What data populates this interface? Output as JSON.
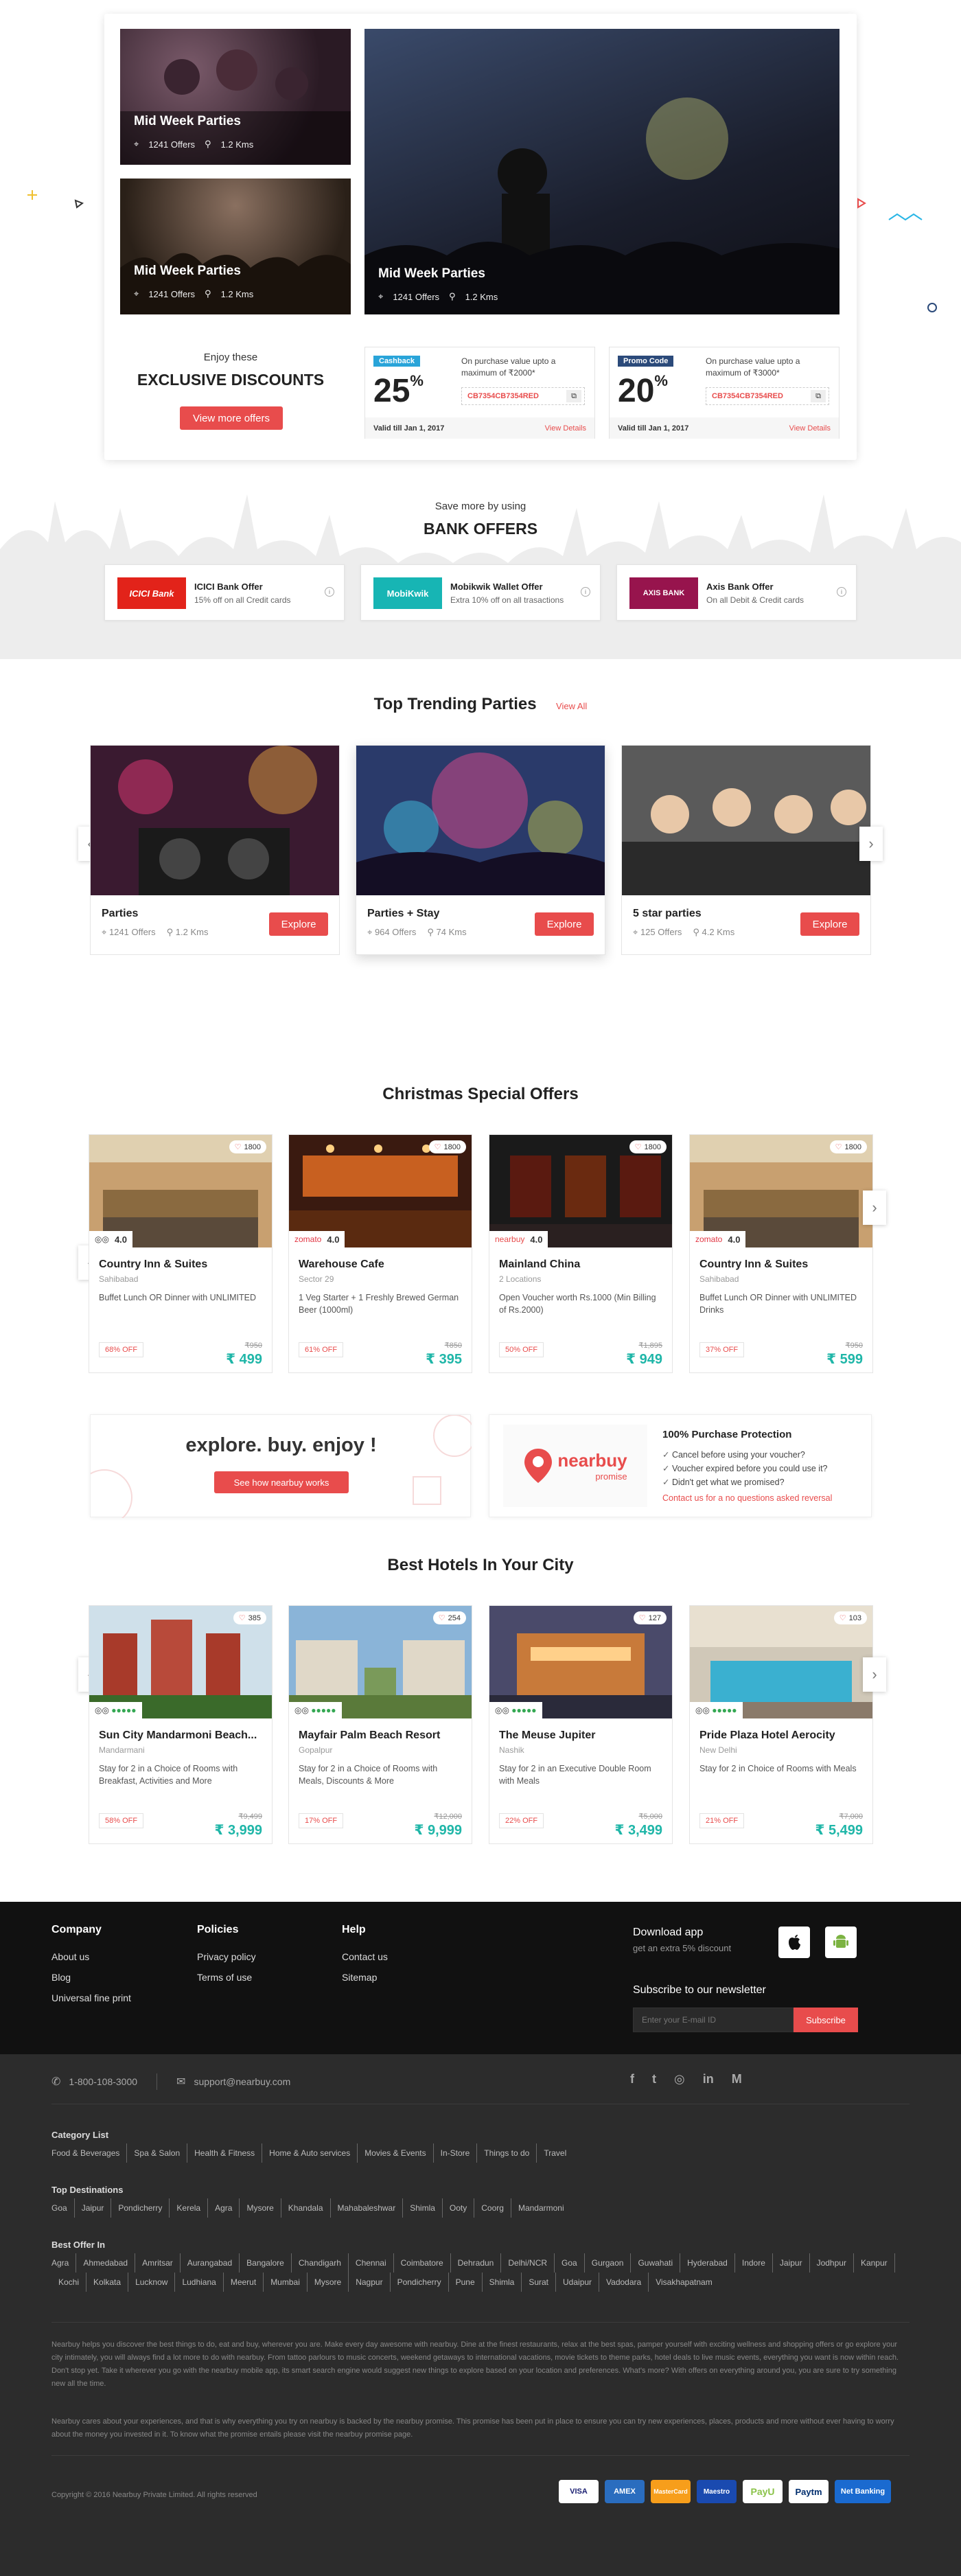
{
  "hero": {
    "tiles": [
      {
        "title": "Mid Week Parties",
        "offers": "1241 Offers",
        "distance": "1.2 Kms"
      },
      {
        "title": "Mid Week Parties",
        "offers": "1241 Offers",
        "distance": "1.2 Kms"
      },
      {
        "title": "Mid Week Parties",
        "offers": "1241 Offers",
        "distance": "1.2 Kms"
      }
    ]
  },
  "discounts": {
    "kicker": "Enjoy these",
    "title": "EXCLUSIVE DISCOUNTS",
    "button": "View more offers",
    "coupons": [
      {
        "tag": "Cashback",
        "value": "25",
        "unit": "%",
        "text": "On purchase value upto a maximum of ₹2000*",
        "code": "CB7354CB7354RED",
        "valid": "Valid till Jan 1, 2017",
        "details": "View Details"
      },
      {
        "tag": "Promo Code",
        "value": "20",
        "unit": "%",
        "text": "On purchase value upto a maximum of ₹3000*",
        "code": "CB7354CB7354RED",
        "valid": "Valid till Jan 1, 2017",
        "details": "View Details"
      }
    ]
  },
  "bank": {
    "kicker": "Save more by using",
    "title": "BANK OFFERS",
    "offers": [
      {
        "logo": "ICICI Bank",
        "name": "ICICI Bank Offer",
        "desc": "15% off on all Credit cards",
        "color": "#e2231a"
      },
      {
        "logo": "MobiKwik",
        "name": "Mobikwik Wallet Offer",
        "desc": "Extra 10% off on all trasactions",
        "color": "#17b5b4"
      },
      {
        "logo": "AXIS BANK",
        "name": "Axis Bank Offer",
        "desc": "On all Debit & Credit cards",
        "color": "#97144d"
      }
    ]
  },
  "trending": {
    "title": "Top Trending Parties",
    "view_all": "View All",
    "cards": [
      {
        "name": "Parties",
        "offers": "1241 Offers",
        "distance": "1.2 Kms",
        "button": "Explore"
      },
      {
        "name": "Parties + Stay",
        "offers": "964 Offers",
        "distance": "74 Kms",
        "button": "Explore"
      },
      {
        "name": "5 star parties",
        "offers": "125 Offers",
        "distance": "4.2 Kms",
        "button": "Explore"
      }
    ]
  },
  "christmas": {
    "title": "Christmas Special Offers",
    "cards": [
      {
        "likes": "1800",
        "source": "tripadvisor",
        "rating": "4.0",
        "name": "Country Inn & Suites",
        "location": "Sahibabad",
        "desc": "Buffet Lunch OR Dinner with UNLIMITED",
        "off": "68% OFF",
        "old": "₹950",
        "price": "₹ 499"
      },
      {
        "likes": "1800",
        "source": "zomato",
        "rating": "4.0",
        "name": "Warehouse Cafe",
        "location": "Sector 29",
        "desc": "1 Veg Starter + 1 Freshly Brewed German Beer (1000ml)",
        "off": "61% OFF",
        "old": "₹850",
        "price": "₹ 395"
      },
      {
        "likes": "1800",
        "source": "nearbuy",
        "rating": "4.0",
        "name": "Mainland China",
        "location": "2 Locations",
        "desc": "Open Voucher worth Rs.1000 (Min Billing of Rs.2000)",
        "off": "50% OFF",
        "old": "₹1,895",
        "price": "₹ 949"
      },
      {
        "likes": "1800",
        "source": "zomato",
        "rating": "4.0",
        "name": "Country Inn & Suites",
        "location": "Sahibabad",
        "desc": "Buffet Lunch OR Dinner with UNLIMITED Drinks",
        "off": "37% OFF",
        "old": "₹950",
        "price": "₹ 599"
      }
    ]
  },
  "promo": {
    "headline": "explore. buy. enjoy !",
    "button": "See how nearbuy works",
    "logo": "nearbuy",
    "logo_sub": "promise",
    "protection_title": "100% Purchase Protection",
    "points": [
      "Cancel before using your voucher?",
      "Voucher expired before you could use it?",
      "Didn't get what we promised?"
    ],
    "link": "Contact us for a no questions asked reversal"
  },
  "hotels": {
    "title": "Best Hotels In Your City",
    "cards": [
      {
        "likes": "385",
        "name": "Sun City Mandarmoni Beach...",
        "location": "Mandarmani",
        "desc": "Stay for 2 in a Choice of Rooms with Breakfast, Activities and More",
        "off": "58% OFF",
        "old": "₹9,499",
        "price": "₹ 3,999"
      },
      {
        "likes": "254",
        "name": "Mayfair Palm Beach Resort",
        "location": "Gopalpur",
        "desc": "Stay for 2 in a Choice of Rooms with Meals, Discounts & More",
        "off": "17% OFF",
        "old": "₹12,000",
        "price": "₹ 9,999"
      },
      {
        "likes": "127",
        "name": "The Meuse Jupiter",
        "location": "Nashik",
        "desc": "Stay for 2 in an Executive Double Room with Meals",
        "off": "22% OFF",
        "old": "₹5,000",
        "price": "₹ 3,499"
      },
      {
        "likes": "103",
        "name": "Pride Plaza Hotel Aerocity",
        "location": "New Delhi",
        "desc": "Stay for 2 in Choice of Rooms with Meals",
        "off": "21% OFF",
        "old": "₹7,000",
        "price": "₹ 5,499"
      }
    ]
  },
  "footer": {
    "company": {
      "title": "Company",
      "links": [
        "About us",
        "Blog",
        "Universal fine print"
      ]
    },
    "policies": {
      "title": "Policies",
      "links": [
        "Privacy policy",
        "Terms of use"
      ]
    },
    "help": {
      "title": "Help",
      "links": [
        "Contact us",
        "Sitemap"
      ]
    },
    "app": {
      "title": "Download app",
      "sub": "get an extra 5% discount"
    },
    "newsletter": {
      "title": "Subscribe to our newsletter",
      "placeholder": "Enter your E-mail ID",
      "button": "Subscribe"
    },
    "phone": "1-800-108-3000",
    "email": "support@nearbuy.com",
    "category_title": "Category List",
    "categories": [
      "Food & Beverages",
      "Spa & Salon",
      "Health & Fitness",
      "Home & Auto services",
      "Movies & Events",
      "In-Store",
      "Things to do",
      "Travel"
    ],
    "destinations_title": "Top Destinations",
    "destinations": [
      "Goa",
      "Jaipur",
      "Pondicherry",
      "Kerela",
      "Agra",
      "Mysore",
      "Khandala",
      "Mahabaleshwar",
      "Shimla",
      "Ooty",
      "Coorg",
      "Mandarmoni"
    ],
    "best_title": "Best Offer In",
    "cities": [
      "Agra",
      "Ahmedabad",
      "Amritsar",
      "Aurangabad",
      "Bangalore",
      "Chandigarh",
      "Chennai",
      "Coimbatore",
      "Dehradun",
      "Delhi/NCR",
      "Goa",
      "Gurgaon",
      "Guwahati",
      "Hyderabad",
      "Indore",
      "Jaipur",
      "Jodhpur",
      "Kanpur",
      "Kochi",
      "Kolkata",
      "Lucknow",
      "Ludhiana",
      "Meerut",
      "Mumbai",
      "Mysore",
      "Nagpur",
      "Pondicherry",
      "Pune",
      "Shimla",
      "Surat",
      "Udaipur",
      "Vadodara",
      "Visakhapatnam"
    ],
    "about1": "Nearbuy helps you discover the best things to do, eat and buy, wherever you are. Make every day awesome with nearbuy. Dine at the finest restaurants, relax at the best spas, pamper yourself with exciting wellness and shopping offers or go explore your city intimately, you will always find a lot more to do with nearbuy. From tattoo parlours to music concerts, weekend getaways to international vacations, movie tickets to theme parks, hotel deals to live music events, everything you want is now within reach. Don't stop yet. Take it wherever you go with the nearbuy mobile app, its smart search engine would suggest new things to explore based on your location and preferences. What's more? With offers on everything around you, you are sure to try something new all the time.",
    "about2": "Nearbuy cares about your experiences, and that is why everything you try on nearbuy is backed by the nearbuy promise. This promise has been put in place to ensure you can try new experiences, places, products and more without ever having to worry about the money you invested in it. To know what the promise entails please visit the nearbuy promise page.",
    "copyright": "Copyright © 2016 Nearbuy Private Limited. All rights reserved",
    "payments": [
      "VISA",
      "AMEX",
      "MasterCard",
      "Maestro",
      "PayU",
      "Paytm",
      "Net Banking"
    ]
  }
}
